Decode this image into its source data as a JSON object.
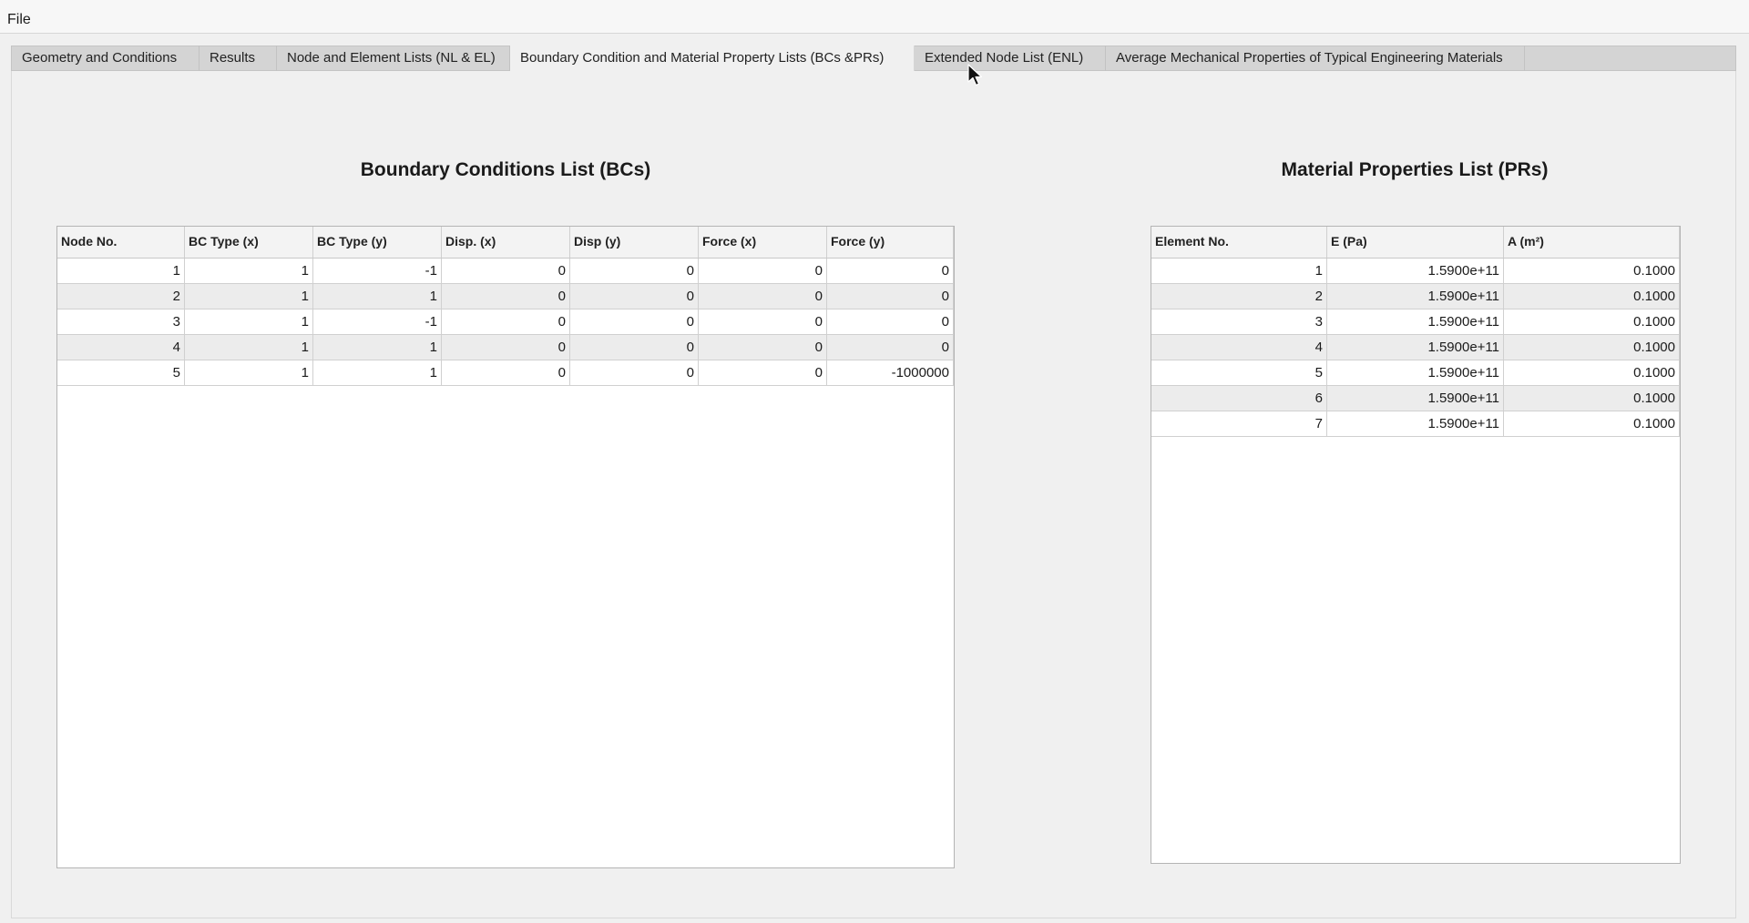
{
  "menu": {
    "file_label": "File"
  },
  "tabs": [
    {
      "label": "Geometry and Conditions"
    },
    {
      "label": "Results"
    },
    {
      "label": "Node and Element Lists (NL & EL)"
    },
    {
      "label": "Boundary Condition and Material Property Lists (BCs &PRs)",
      "active": true
    },
    {
      "label": "Extended Node List (ENL)"
    },
    {
      "label": "Average Mechanical Properties of Typical Engineering Materials"
    }
  ],
  "bcs": {
    "title": "Boundary Conditions List (BCs)",
    "columns": [
      "Node No.",
      "BC Type (x)",
      "BC Type (y)",
      "Disp. (x)",
      "Disp (y)",
      "Force (x)",
      "Force (y)"
    ],
    "rows": [
      [
        "1",
        "1",
        "-1",
        "0",
        "0",
        "0",
        "0"
      ],
      [
        "2",
        "1",
        "1",
        "0",
        "0",
        "0",
        "0"
      ],
      [
        "3",
        "1",
        "-1",
        "0",
        "0",
        "0",
        "0"
      ],
      [
        "4",
        "1",
        "1",
        "0",
        "0",
        "0",
        "0"
      ],
      [
        "5",
        "1",
        "1",
        "0",
        "0",
        "0",
        "-1000000"
      ]
    ]
  },
  "prs": {
    "title": "Material Properties List (PRs)",
    "columns": [
      "Element No.",
      "E (Pa)",
      "A (m²)"
    ],
    "rows": [
      [
        "1",
        "1.5900e+11",
        "0.1000"
      ],
      [
        "2",
        "1.5900e+11",
        "0.1000"
      ],
      [
        "3",
        "1.5900e+11",
        "0.1000"
      ],
      [
        "4",
        "1.5900e+11",
        "0.1000"
      ],
      [
        "5",
        "1.5900e+11",
        "0.1000"
      ],
      [
        "6",
        "1.5900e+11",
        "0.1000"
      ],
      [
        "7",
        "1.5900e+11",
        "0.1000"
      ]
    ]
  }
}
